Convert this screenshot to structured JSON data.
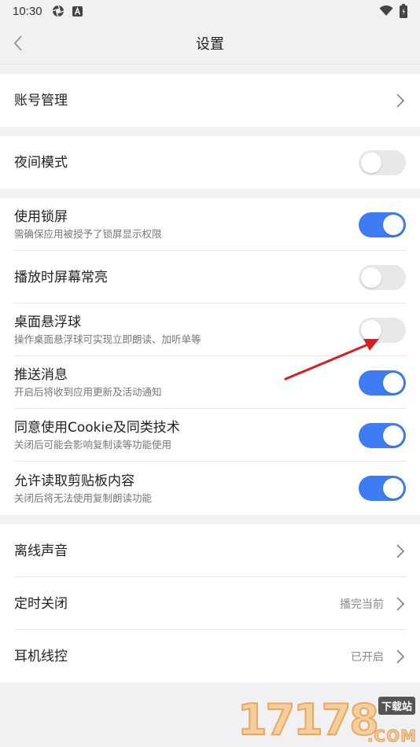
{
  "status_bar": {
    "time": "10:30"
  },
  "header": {
    "title": "设置"
  },
  "sections": [
    {
      "rows": [
        {
          "label": "账号管理",
          "type": "chevron"
        }
      ]
    },
    {
      "rows": [
        {
          "label": "夜间模式",
          "type": "toggle",
          "on": false
        }
      ]
    },
    {
      "rows": [
        {
          "label": "使用锁屏",
          "sub": "需确保应用被授予了锁屏显示权限",
          "type": "toggle",
          "on": true
        },
        {
          "label": "播放时屏幕常亮",
          "type": "toggle",
          "on": false
        },
        {
          "label": "桌面悬浮球",
          "sub": "操作桌面悬浮球可实现立即朗读、加听单等",
          "type": "toggle",
          "on": false
        },
        {
          "label": "推送消息",
          "sub": "开启后将收到应用更新及活动通知",
          "type": "toggle",
          "on": true
        },
        {
          "label": "同意使用Cookie及同类技术",
          "sub": "关闭后可能会影响复制读等功能使用",
          "type": "toggle",
          "on": true
        },
        {
          "label": "允许读取剪贴板内容",
          "sub": "关闭后将无法使用复制朗读功能",
          "type": "toggle",
          "on": true
        }
      ]
    },
    {
      "rows": [
        {
          "label": "离线声音",
          "type": "chevron"
        },
        {
          "label": "定时关闭",
          "value": "播完当前",
          "type": "chevron"
        },
        {
          "label": "耳机线控",
          "value": "已开启",
          "type": "chevron"
        }
      ]
    }
  ],
  "watermark": {
    "number": "17178",
    "badge": "下载站",
    "domain": ".COM"
  },
  "colors": {
    "accent": "#3d7cf5",
    "annotation_arrow": "#d42020"
  }
}
